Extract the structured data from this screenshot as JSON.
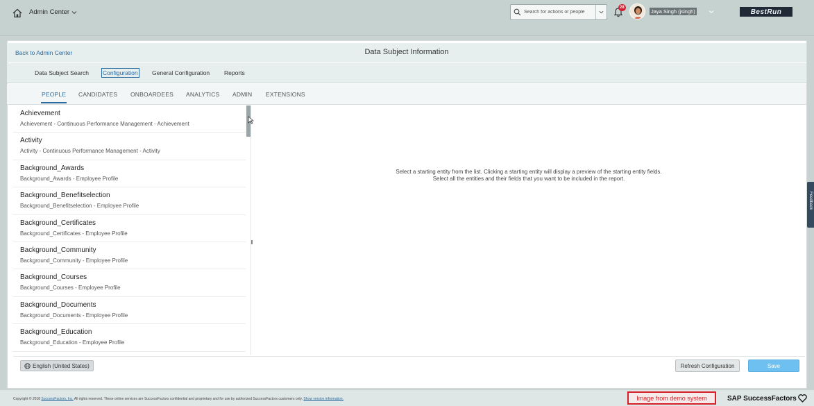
{
  "shell": {
    "app_title": "Admin Center",
    "search_placeholder": "Search for actions or people",
    "notification_count": "28",
    "user_name": "Jaya Singh (jsingh)",
    "logo_text": "BestRun"
  },
  "header": {
    "back_link": "Back to Admin Center",
    "page_title": "Data Subject Information"
  },
  "top_tabs": [
    {
      "label": "Data Subject Search"
    },
    {
      "label": "Configuration"
    },
    {
      "label": "General Configuration"
    },
    {
      "label": "Reports"
    }
  ],
  "category_tabs": [
    {
      "label": "PEOPLE"
    },
    {
      "label": "CANDIDATES"
    },
    {
      "label": "ONBOARDEES"
    },
    {
      "label": "ANALYTICS"
    },
    {
      "label": "ADMIN"
    },
    {
      "label": "EXTENSIONS"
    }
  ],
  "entities": [
    {
      "title": "Achievement",
      "subtitle": "Achievement - Continuous Performance Management - Achievement"
    },
    {
      "title": "Activity",
      "subtitle": "Activity - Continuous Performance Management - Activity"
    },
    {
      "title": "Background_Awards",
      "subtitle": "Background_Awards - Employee Profile"
    },
    {
      "title": "Background_Benefitselection",
      "subtitle": "Background_Benefitselection - Employee Profile"
    },
    {
      "title": "Background_Certificates",
      "subtitle": "Background_Certificates - Employee Profile"
    },
    {
      "title": "Background_Community",
      "subtitle": "Background_Community - Employee Profile"
    },
    {
      "title": "Background_Courses",
      "subtitle": "Background_Courses - Employee Profile"
    },
    {
      "title": "Background_Documents",
      "subtitle": "Background_Documents - Employee Profile"
    },
    {
      "title": "Background_Education",
      "subtitle": "Background_Education - Employee Profile"
    }
  ],
  "detail": {
    "line1": "Select a starting entity from the list. Clicking a starting entity will display a preview of the starting entity fields.",
    "line2": "Select all the entities and their fields that you want to be included in the report."
  },
  "feedback_label": "Feedback",
  "footer": {
    "language": "English (United States)",
    "refresh_label": "Refresh Configuration",
    "save_label": "Save"
  },
  "page_footer": {
    "copyright_prefix": "Copyright © 2018 ",
    "copyright_company": "SuccessFactors, Inc.",
    "copyright_rest": " All rights reserved. These online services are SuccessFactors confidential and proprietary and for use by authorized SuccessFactors customers only. ",
    "version_link": "Show version information.",
    "demo_label": "Image from demo system",
    "brand": "SAP SuccessFactors"
  },
  "colors": {
    "accent": "#2b6a9f",
    "save_button": "#6ec0f0",
    "demo_border": "#d62028"
  }
}
